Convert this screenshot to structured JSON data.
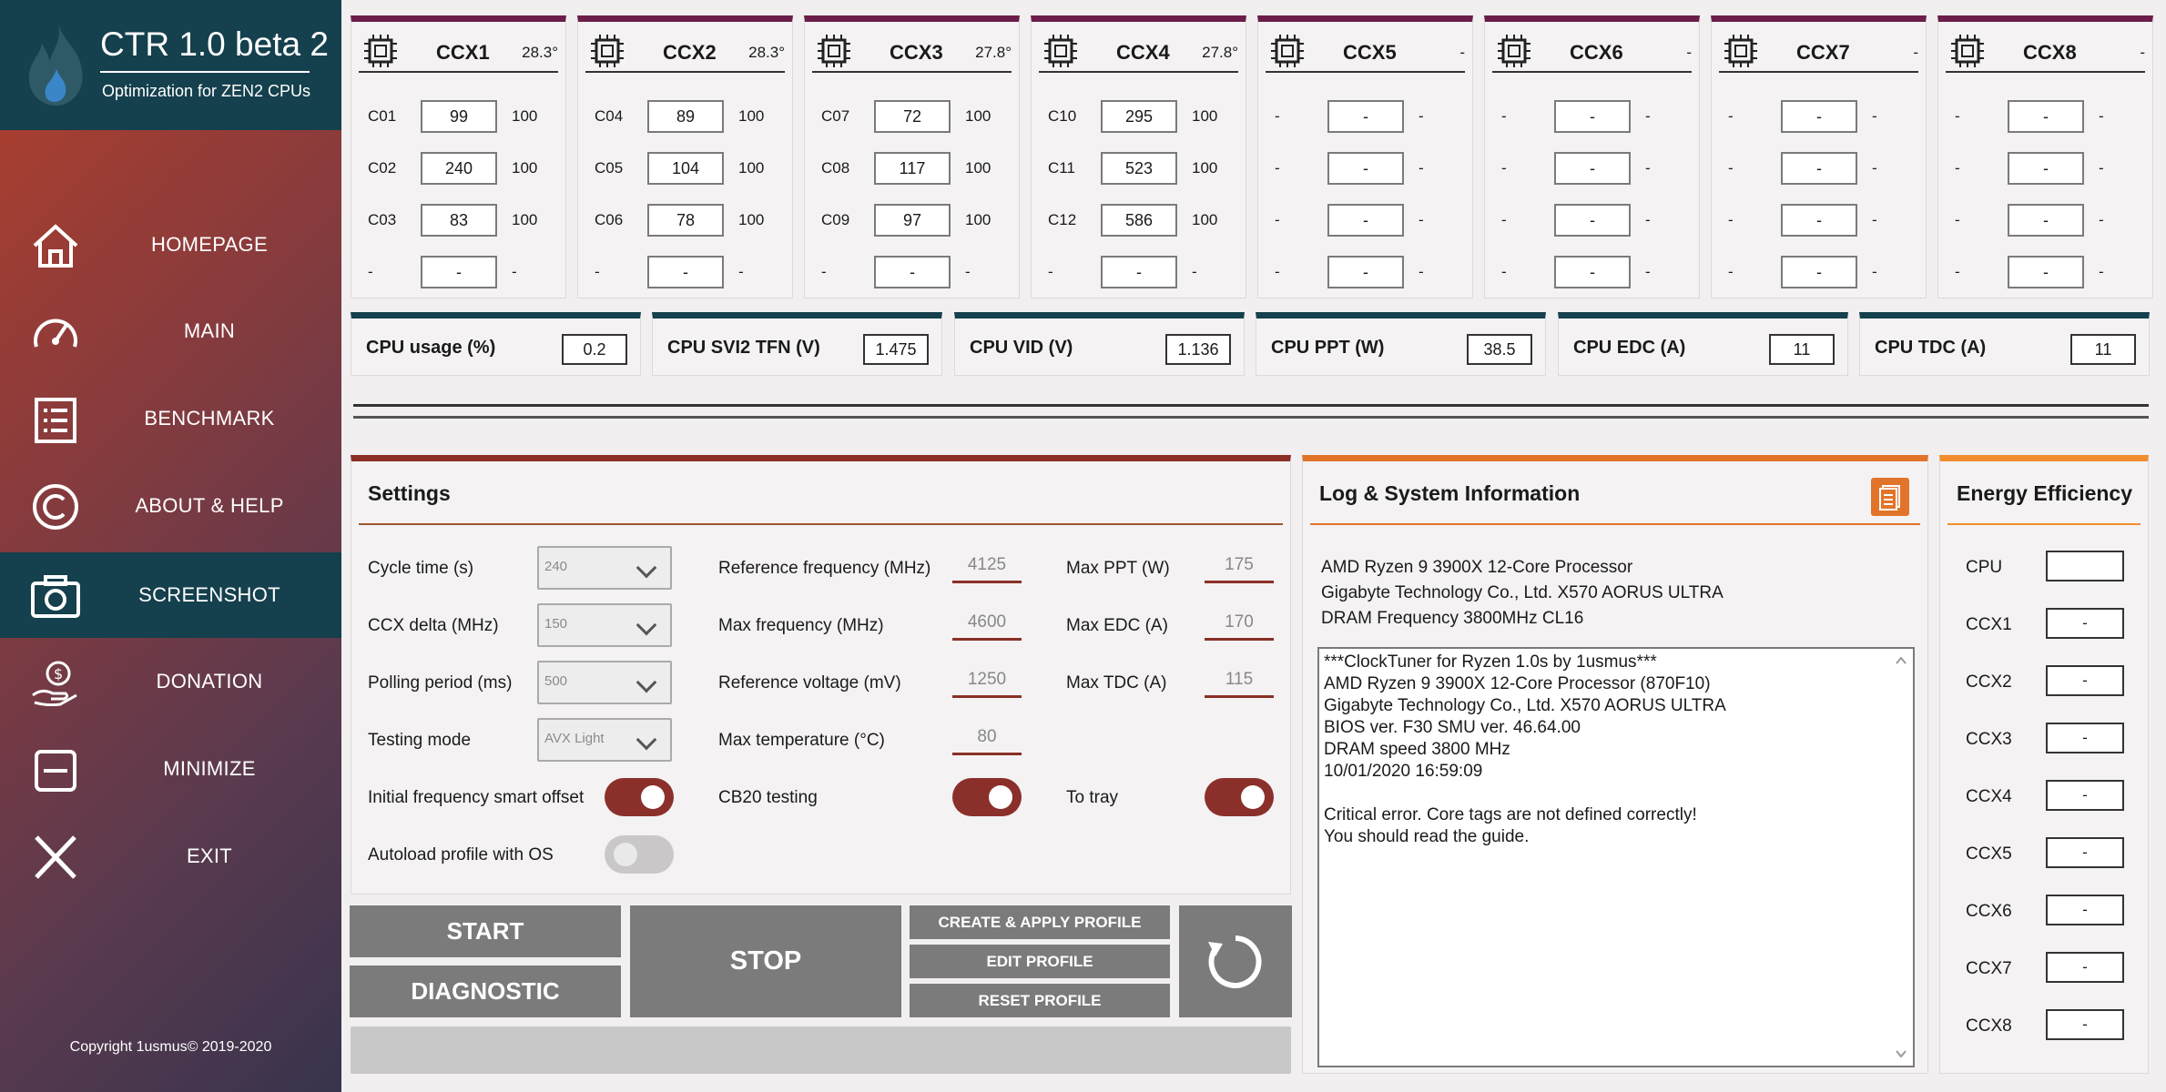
{
  "app": {
    "title": "CTR 1.0 beta 2",
    "subtitle": "Optimization for ZEN2 CPUs",
    "copyright": "Copyright 1usmus© 2019-2020"
  },
  "nav": [
    {
      "label": "HOMEPAGE",
      "icon": "home-icon",
      "active": false
    },
    {
      "label": "MAIN",
      "icon": "gauge-icon",
      "active": false
    },
    {
      "label": "BENCHMARK",
      "icon": "list-icon",
      "active": false
    },
    {
      "label": "ABOUT & HELP",
      "icon": "copyright-icon",
      "active": false
    },
    {
      "label": "SCREENSHOT",
      "icon": "camera-icon",
      "active": true
    },
    {
      "label": "DONATION",
      "icon": "donation-hand-icon",
      "active": false
    },
    {
      "label": "MINIMIZE",
      "icon": "minimize-icon",
      "active": false
    },
    {
      "label": "EXIT",
      "icon": "close-icon",
      "active": false
    }
  ],
  "ccx": [
    {
      "name": "CCX1",
      "temp": "28.3°",
      "rows": [
        [
          "C01",
          "99",
          "100"
        ],
        [
          "C02",
          "240",
          "100"
        ],
        [
          "C03",
          "83",
          "100"
        ],
        [
          "-",
          "-",
          "-"
        ]
      ]
    },
    {
      "name": "CCX2",
      "temp": "28.3°",
      "rows": [
        [
          "C04",
          "89",
          "100"
        ],
        [
          "C05",
          "104",
          "100"
        ],
        [
          "C06",
          "78",
          "100"
        ],
        [
          "-",
          "-",
          "-"
        ]
      ]
    },
    {
      "name": "CCX3",
      "temp": "27.8°",
      "rows": [
        [
          "C07",
          "72",
          "100"
        ],
        [
          "C08",
          "117",
          "100"
        ],
        [
          "C09",
          "97",
          "100"
        ],
        [
          "-",
          "-",
          "-"
        ]
      ]
    },
    {
      "name": "CCX4",
      "temp": "27.8°",
      "rows": [
        [
          "C10",
          "295",
          "100"
        ],
        [
          "C11",
          "523",
          "100"
        ],
        [
          "C12",
          "586",
          "100"
        ],
        [
          "-",
          "-",
          "-"
        ]
      ]
    },
    {
      "name": "CCX5",
      "temp": "-",
      "rows": [
        [
          "-",
          "-",
          "-"
        ],
        [
          "-",
          "-",
          "-"
        ],
        [
          "-",
          "-",
          "-"
        ],
        [
          "-",
          "-",
          "-"
        ]
      ]
    },
    {
      "name": "CCX6",
      "temp": "-",
      "rows": [
        [
          "-",
          "-",
          "-"
        ],
        [
          "-",
          "-",
          "-"
        ],
        [
          "-",
          "-",
          "-"
        ],
        [
          "-",
          "-",
          "-"
        ]
      ]
    },
    {
      "name": "CCX7",
      "temp": "-",
      "rows": [
        [
          "-",
          "-",
          "-"
        ],
        [
          "-",
          "-",
          "-"
        ],
        [
          "-",
          "-",
          "-"
        ],
        [
          "-",
          "-",
          "-"
        ]
      ]
    },
    {
      "name": "CCX8",
      "temp": "-",
      "rows": [
        [
          "-",
          "-",
          "-"
        ],
        [
          "-",
          "-",
          "-"
        ],
        [
          "-",
          "-",
          "-"
        ],
        [
          "-",
          "-",
          "-"
        ]
      ]
    }
  ],
  "metrics": [
    {
      "label": "CPU usage (%)",
      "value": "0.2"
    },
    {
      "label": "CPU SVI2 TFN (V)",
      "value": "1.475"
    },
    {
      "label": "CPU VID (V)",
      "value": "1.136"
    },
    {
      "label": "CPU PPT (W)",
      "value": "38.5"
    },
    {
      "label": "CPU EDC (A)",
      "value": "11"
    },
    {
      "label": "CPU TDC (A)",
      "value": "11"
    }
  ],
  "settings": {
    "title": "Settings",
    "cycle_time": {
      "label": "Cycle time (s)",
      "value": "240"
    },
    "ccx_delta": {
      "label": "CCX delta (MHz)",
      "value": "150"
    },
    "polling": {
      "label": "Polling period (ms)",
      "value": "500"
    },
    "testing_mode": {
      "label": "Testing mode",
      "value": "AVX Light"
    },
    "ref_freq": {
      "label": "Reference frequency (MHz)",
      "value": "4125"
    },
    "max_freq": {
      "label": "Max frequency (MHz)",
      "value": "4600"
    },
    "ref_volt": {
      "label": "Reference voltage (mV)",
      "value": "1250"
    },
    "max_temp": {
      "label": "Max temperature (°C)",
      "value": "80"
    },
    "max_ppt": {
      "label": "Max PPT (W)",
      "value": "175"
    },
    "max_edc": {
      "label": "Max EDC (A)",
      "value": "170"
    },
    "max_tdc": {
      "label": "Max TDC (A)",
      "value": "115"
    },
    "smart_offset": {
      "label": "Initial frequency smart offset",
      "on": true
    },
    "cb20": {
      "label": "CB20 testing",
      "on": true
    },
    "tray": {
      "label": "To tray",
      "on": true
    },
    "autoload": {
      "label": "Autoload profile with OS",
      "on": false
    }
  },
  "buttons": {
    "start": "START",
    "diagnostic": "DIAGNOSTIC",
    "stop": "STOP",
    "create_apply": "CREATE & APPLY PROFILE",
    "edit": "EDIT PROFILE",
    "reset": "RESET PROFILE"
  },
  "log": {
    "title": "Log & System Information",
    "sysinfo": [
      "AMD Ryzen 9 3900X 12-Core Processor",
      "Gigabyte Technology Co., Ltd. X570 AORUS ULTRA",
      "DRAM Frequency 3800MHz CL16"
    ],
    "lines": [
      "***ClockTuner for Ryzen 1.0s by 1usmus***",
      "AMD Ryzen 9 3900X 12-Core Processor (870F10)",
      "Gigabyte Technology Co., Ltd. X570 AORUS ULTRA",
      "BIOS ver. F30 SMU ver. 46.64.00",
      "DRAM speed 3800 MHz",
      "10/01/2020 16:59:09",
      "",
      "Critical error. Core tags are not defined correctly!",
      "You should read the guide."
    ]
  },
  "energy": {
    "title": "Energy Efficiency",
    "rows": [
      {
        "label": "CPU",
        "value": ""
      },
      {
        "label": "CCX1",
        "value": "-"
      },
      {
        "label": "CCX2",
        "value": "-"
      },
      {
        "label": "CCX3",
        "value": "-"
      },
      {
        "label": "CCX4",
        "value": "-"
      },
      {
        "label": "CCX5",
        "value": "-"
      },
      {
        "label": "CCX6",
        "value": "-"
      },
      {
        "label": "CCX7",
        "value": "-"
      },
      {
        "label": "CCX8",
        "value": "-"
      }
    ]
  }
}
